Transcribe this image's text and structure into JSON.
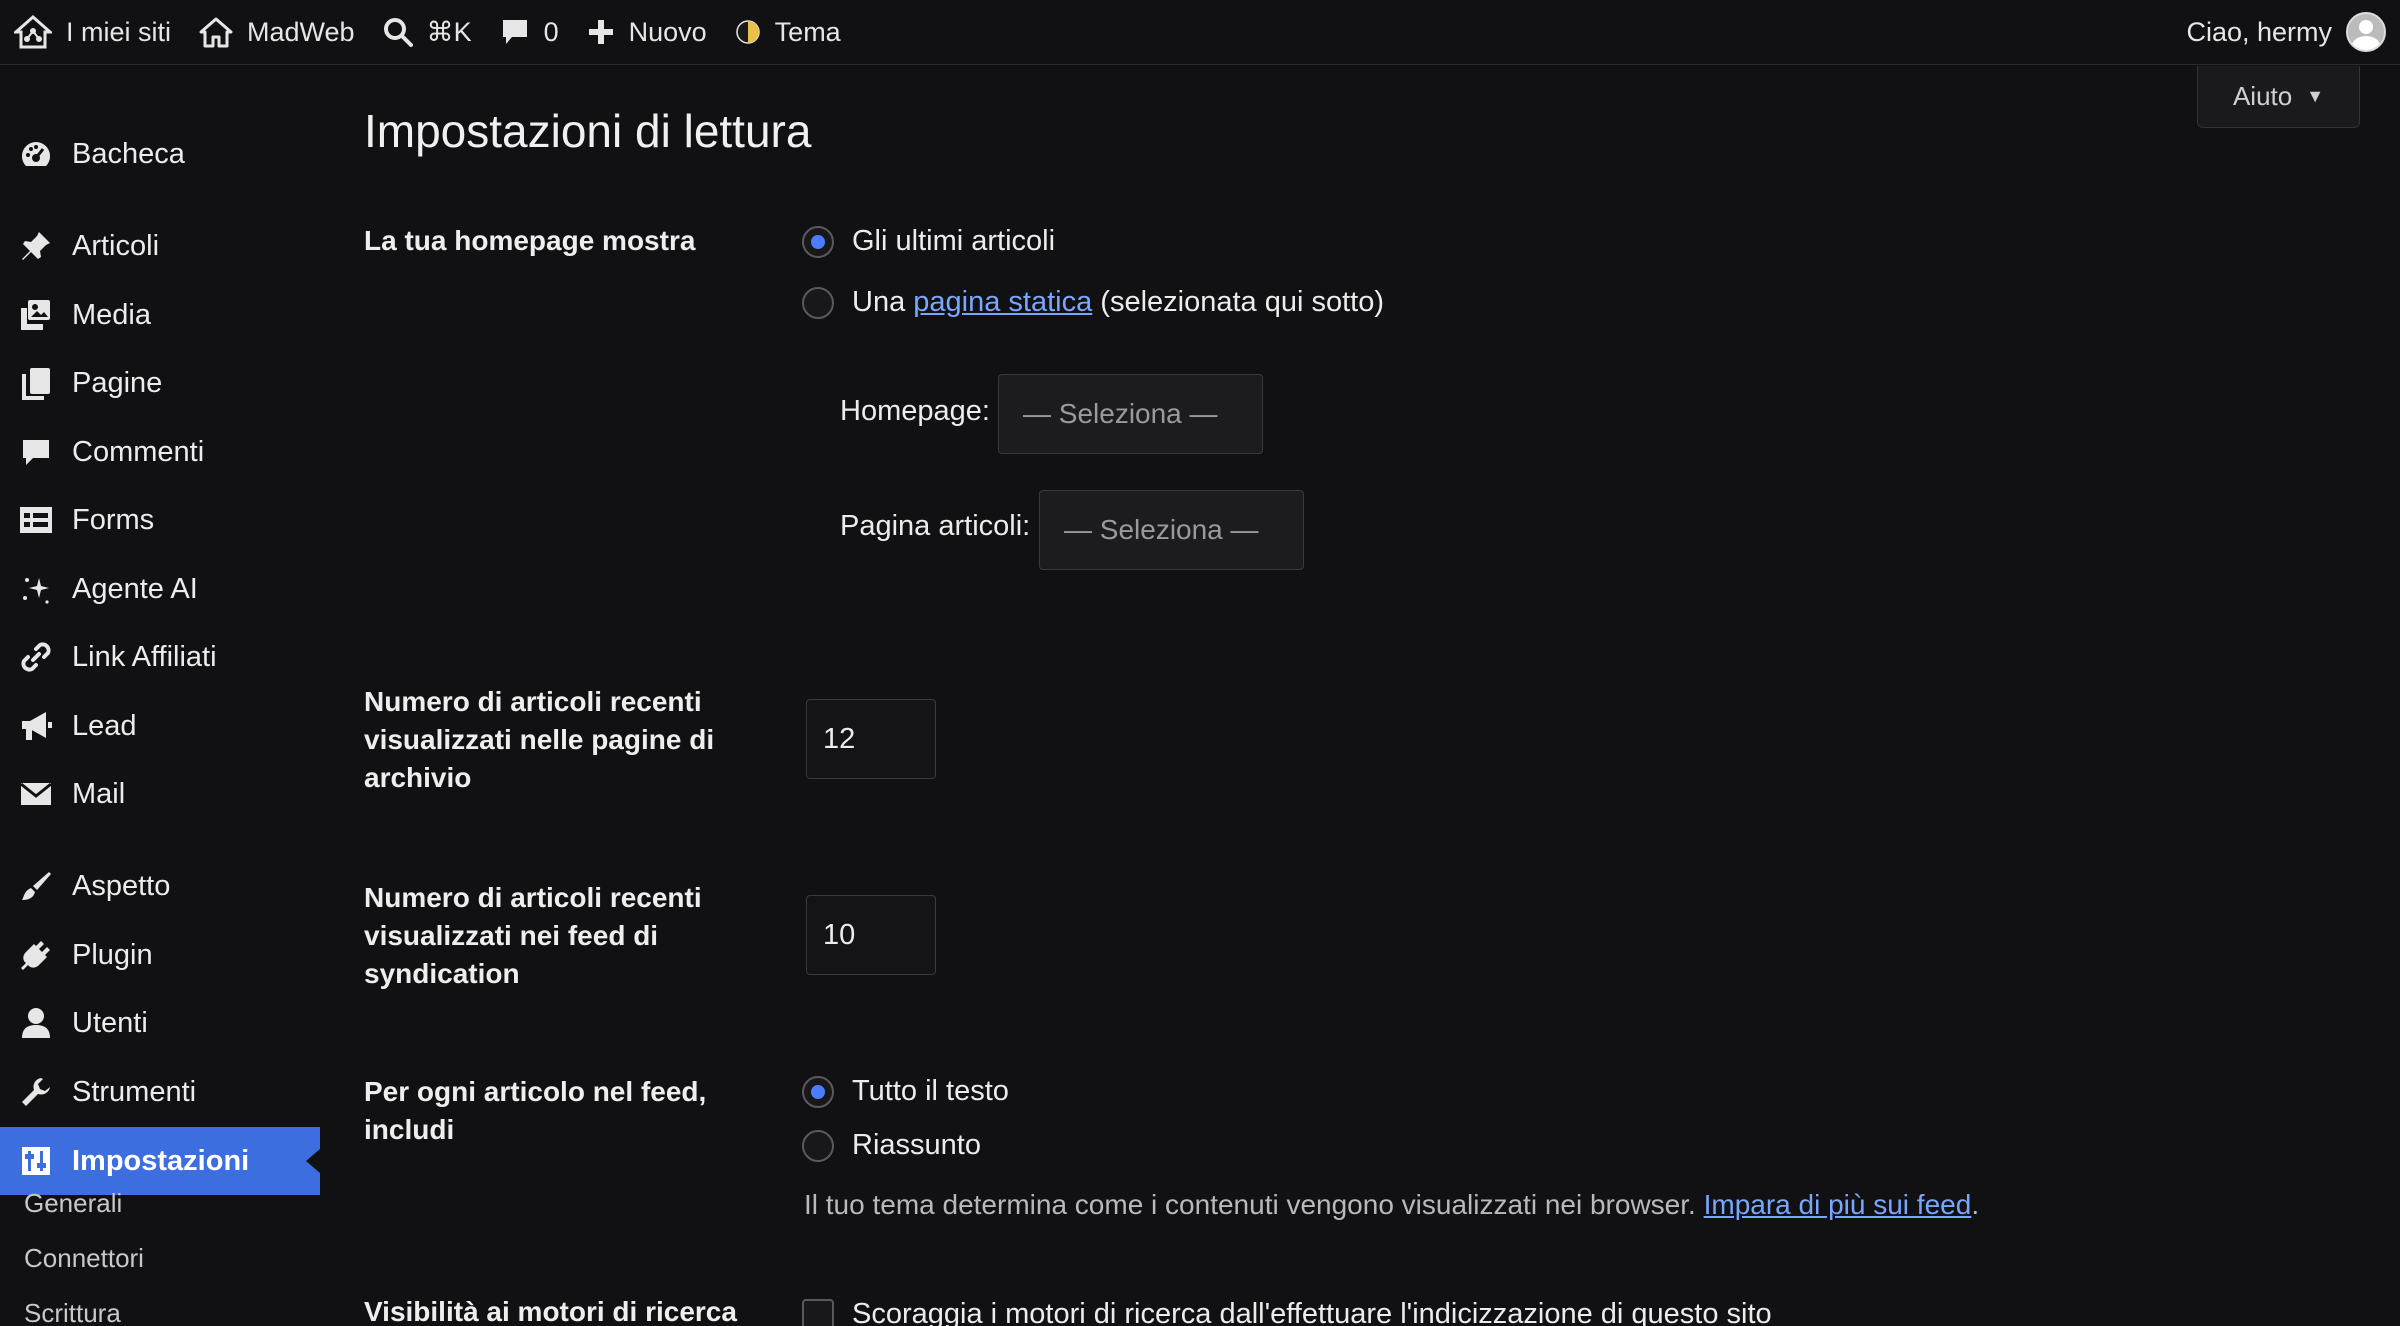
{
  "adminbar": {
    "my_sites": "I miei siti",
    "site_name": "MadWeb",
    "search_shortcut": "⌘K",
    "comments_count": "0",
    "new_label": "Nuovo",
    "theme_label": "Tema",
    "greeting": "Ciao, hermy"
  },
  "sidebar": {
    "items": [
      {
        "label": "Bacheca",
        "icon": "dashboard-icon"
      },
      {
        "label": "Articoli",
        "icon": "pin-icon"
      },
      {
        "label": "Media",
        "icon": "media-icon"
      },
      {
        "label": "Pagine",
        "icon": "pages-icon"
      },
      {
        "label": "Commenti",
        "icon": "comment-icon"
      },
      {
        "label": "Forms",
        "icon": "forms-icon"
      },
      {
        "label": "Agente AI",
        "icon": "sparkle-icon"
      },
      {
        "label": "Link Affiliati",
        "icon": "link-icon"
      },
      {
        "label": "Lead",
        "icon": "megaphone-icon"
      },
      {
        "label": "Mail",
        "icon": "mail-icon"
      },
      {
        "label": "Aspetto",
        "icon": "brush-icon"
      },
      {
        "label": "Plugin",
        "icon": "plug-icon"
      },
      {
        "label": "Utenti",
        "icon": "user-icon"
      },
      {
        "label": "Strumenti",
        "icon": "wrench-icon"
      },
      {
        "label": "Impostazioni",
        "icon": "settings-icon",
        "active": true
      }
    ],
    "submenu": [
      "Generali",
      "Connettori",
      "Scrittura"
    ]
  },
  "help_button": "Aiuto",
  "page_title": "Impostazioni di lettura",
  "homepage": {
    "label": "La tua homepage mostra",
    "option_latest": "Gli ultimi articoli",
    "option_static_prefix": "Una",
    "option_static_link": "pagina statica",
    "option_static_suffix": "(selezionata qui sotto)",
    "selected": "latest",
    "homepage_label": "Homepage:",
    "homepage_select": "— Seleziona —",
    "posts_page_label": "Pagina articoli:",
    "posts_page_select": "— Seleziona —"
  },
  "posts_per_page": {
    "label": "Numero di articoli recenti visualizzati nelle pagine di archivio",
    "value": "12"
  },
  "posts_per_rss": {
    "label": "Numero di articoli recenti visualizzati nei feed di syndication",
    "value": "10"
  },
  "feed_content": {
    "label": "Per ogni articolo nel feed, includi",
    "option_full": "Tutto il testo",
    "option_summary": "Riassunto",
    "selected": "full",
    "desc_text": "Il tuo tema determina come i contenuti vengono visualizzati nei browser.",
    "desc_link": "Impara di più sui feed",
    "desc_end": "."
  },
  "search_visibility": {
    "label": "Visibilità ai motori di ricerca",
    "checkbox_label": "Scoraggia i motori di ricerca dall'effettuare l'indicizzazione di questo sito",
    "checked": false
  },
  "colors": {
    "background": "#111113",
    "accent": "#3d6ee0",
    "radio_checked": "#4a7dff",
    "link": "#79a6ff"
  }
}
